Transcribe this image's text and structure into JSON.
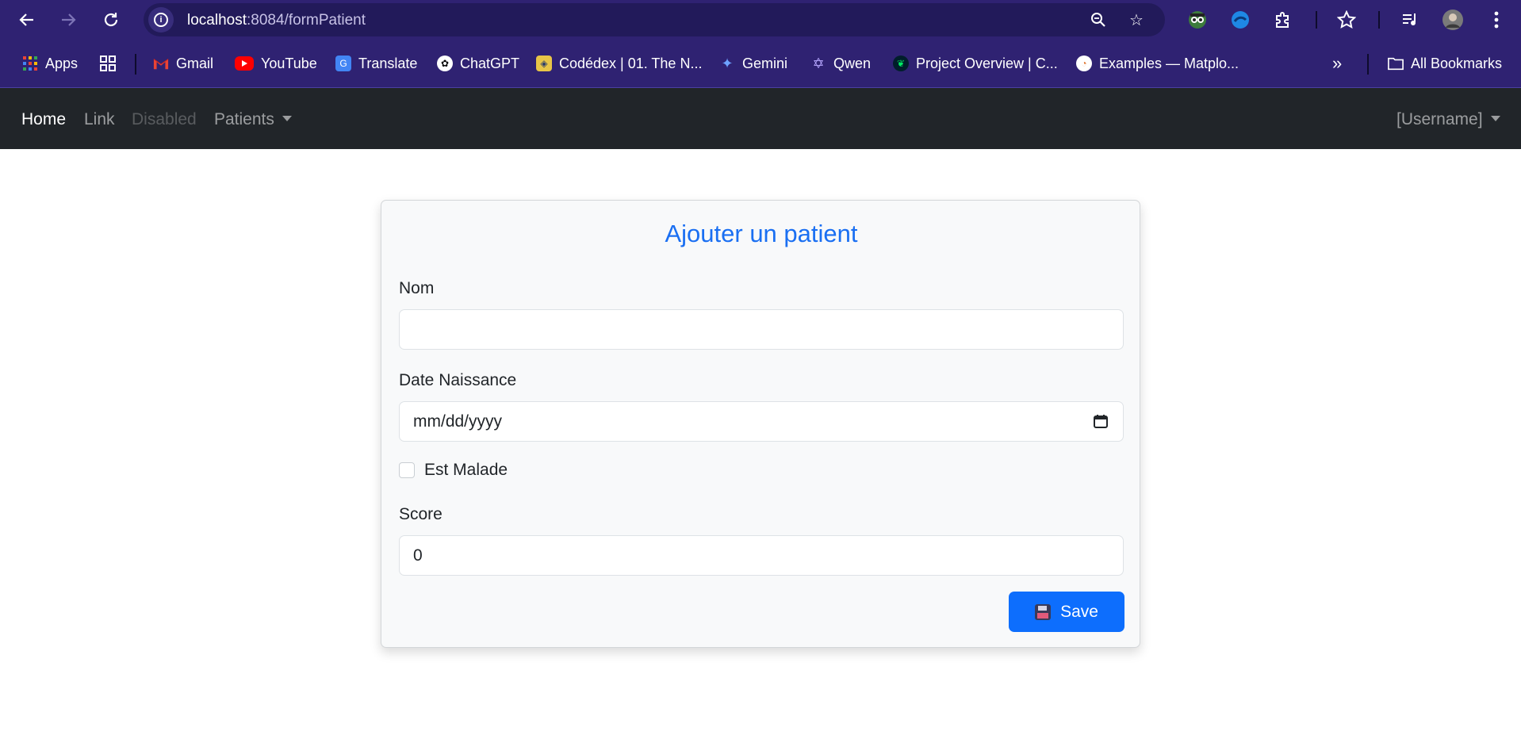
{
  "browser": {
    "url_host": "localhost",
    "url_path": ":8084/formPatient",
    "bookmarks": [
      {
        "label": "Apps"
      },
      {
        "label": "Gmail"
      },
      {
        "label": "YouTube"
      },
      {
        "label": "Translate"
      },
      {
        "label": "ChatGPT"
      },
      {
        "label": "Codédex | 01. The N..."
      },
      {
        "label": "Gemini"
      },
      {
        "label": "Qwen"
      },
      {
        "label": "Project Overview | C..."
      },
      {
        "label": "Examples — Matplo..."
      }
    ],
    "overflow_label": "»",
    "all_bookmarks_label": "All Bookmarks"
  },
  "navbar": {
    "home": "Home",
    "link": "Link",
    "disabled": "Disabled",
    "patients": "Patients",
    "username": "[Username]"
  },
  "form": {
    "title": "Ajouter un patient",
    "nom_label": "Nom",
    "nom_value": "",
    "date_label": "Date Naissance",
    "date_placeholder": "mm/dd/yyyy",
    "malade_label": "Est Malade",
    "malade_checked": false,
    "score_label": "Score",
    "score_value": "0",
    "save_label": "Save"
  }
}
